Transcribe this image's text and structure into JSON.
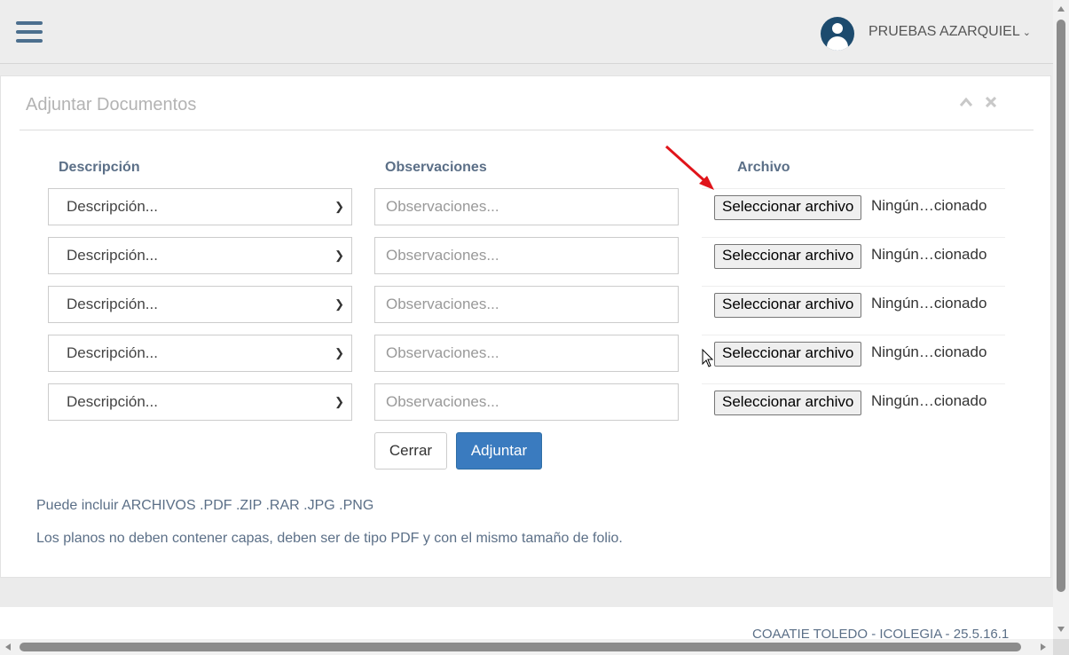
{
  "header": {
    "user_name": "PRUEBAS AZARQUIEL",
    "user_chevron": "⌄",
    "menu_icon": "hamburger-icon",
    "avatar_icon": "user-avatar-icon"
  },
  "panel": {
    "title": "Adjuntar Documentos",
    "collapse_icon": "chevron-up-icon",
    "close_icon": "close-icon"
  },
  "table": {
    "headers": {
      "descripcion": "Descripción",
      "observaciones": "Observaciones",
      "archivo": "Archivo"
    },
    "rows": [
      {
        "descripcion": "Descripción...",
        "observaciones_placeholder": "Observaciones...",
        "file_button": "Seleccionar archivo",
        "file_status": "Ningún…cionado"
      },
      {
        "descripcion": "Descripción...",
        "observaciones_placeholder": "Observaciones...",
        "file_button": "Seleccionar archivo",
        "file_status": "Ningún…cionado"
      },
      {
        "descripcion": "Descripción...",
        "observaciones_placeholder": "Observaciones...",
        "file_button": "Seleccionar archivo",
        "file_status": "Ningún…cionado"
      },
      {
        "descripcion": "Descripción...",
        "observaciones_placeholder": "Observaciones...",
        "file_button": "Seleccionar archivo",
        "file_status": "Ningún…cionado"
      },
      {
        "descripcion": "Descripción...",
        "observaciones_placeholder": "Observaciones...",
        "file_button": "Seleccionar archivo",
        "file_status": "Ningún…cionado"
      }
    ]
  },
  "actions": {
    "cerrar": "Cerrar",
    "adjuntar": "Adjuntar"
  },
  "notes": {
    "formats": "Puede incluir ARCHIVOS .PDF .ZIP .RAR .JPG .PNG",
    "planos": "Los planos no deben contener capas, deben ser de tipo PDF y con el mismo tamaño de folio."
  },
  "footer": {
    "text": "COAATIE TOLEDO - ICOLEGIA - 25.5.16.1"
  },
  "colors": {
    "primary": "#3a7bbf",
    "label": "#5b6f87",
    "annotation_arrow": "#e0141a"
  }
}
